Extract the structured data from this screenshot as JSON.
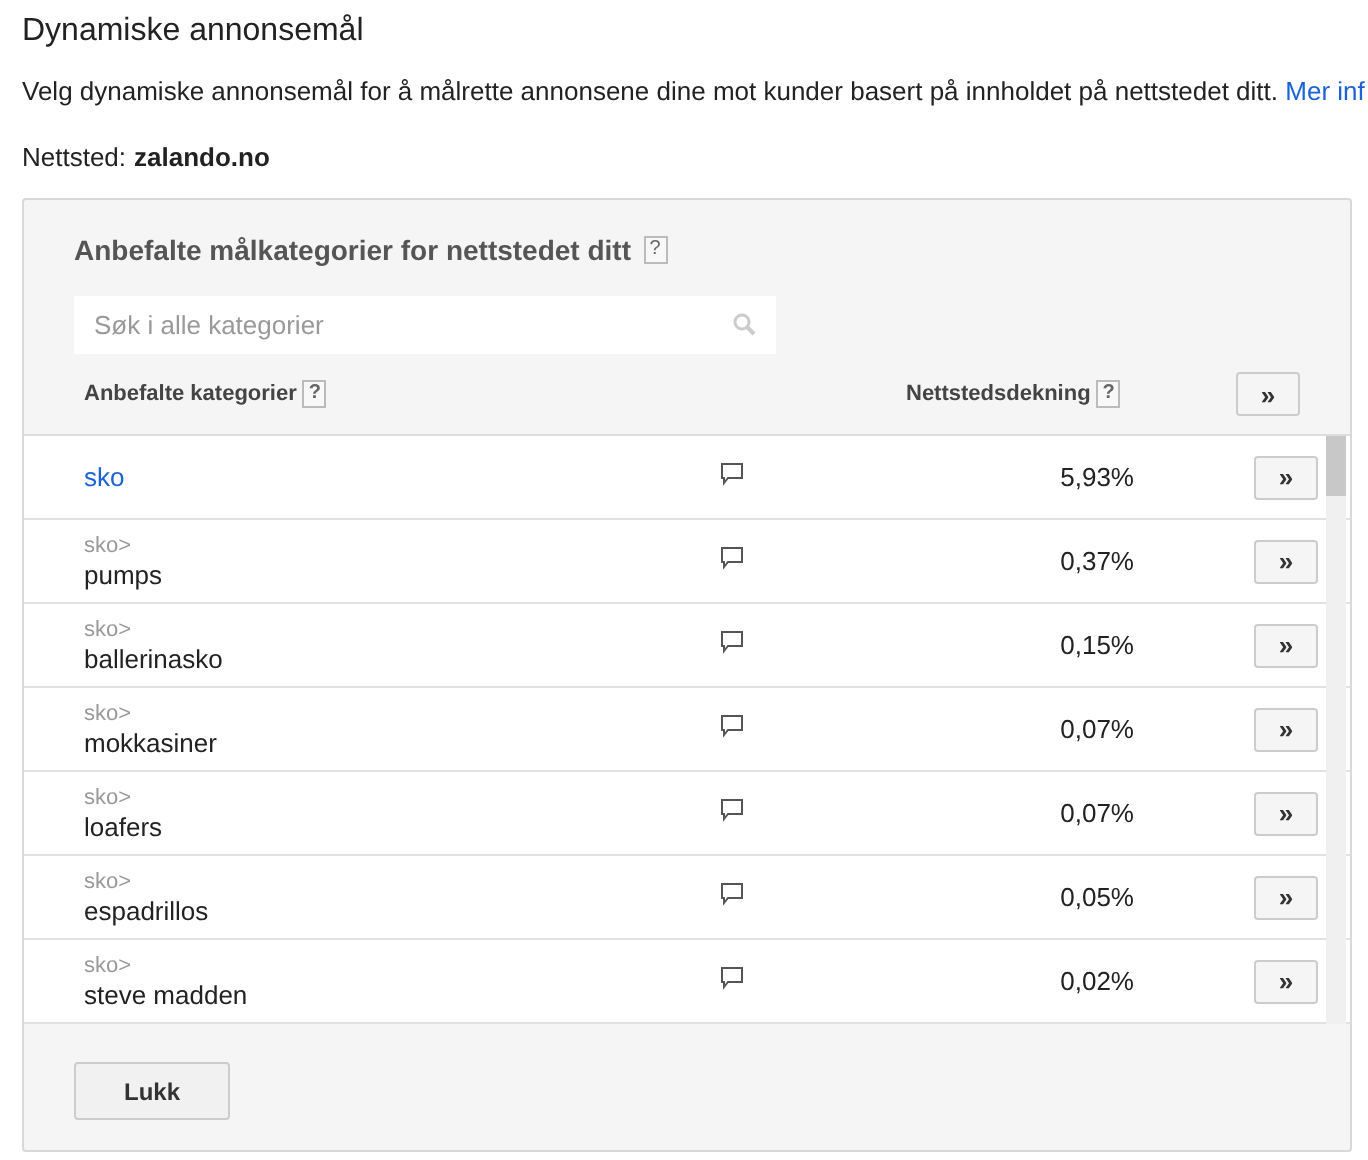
{
  "title": "Dynamiske annonsemål",
  "description": "Velg dynamiske annonsemål for å målrette annonsene dine mot kunder basert på innholdet på nettstedet ditt.",
  "more_link": "Mer inf",
  "site": {
    "label": "Nettsted:",
    "value": "zalando.no"
  },
  "panel": {
    "heading": "Anbefalte målkategorier for nettstedet ditt",
    "help": "?",
    "search": {
      "placeholder": "Søk i alle kategorier"
    },
    "columns": [
      {
        "label": "Anbefalte kategorier",
        "help": "?"
      },
      {
        "label": "Nettstedsdekning",
        "help": "?"
      }
    ],
    "add_all_button": "»",
    "rows": [
      {
        "kind": "top",
        "name": "sko",
        "coverage": "5,93%",
        "button": "»"
      },
      {
        "kind": "child",
        "parent": "sko>",
        "name": "pumps",
        "coverage": "0,37%",
        "button": "»"
      },
      {
        "kind": "child",
        "parent": "sko>",
        "name": "ballerinasko",
        "coverage": "0,15%",
        "button": "»"
      },
      {
        "kind": "child",
        "parent": "sko>",
        "name": "mokkasiner",
        "coverage": "0,07%",
        "button": "»"
      },
      {
        "kind": "child",
        "parent": "sko>",
        "name": "loafers",
        "coverage": "0,07%",
        "button": "»"
      },
      {
        "kind": "child",
        "parent": "sko>",
        "name": "espadrillos",
        "coverage": "0,05%",
        "button": "»"
      },
      {
        "kind": "child",
        "parent": "sko>",
        "name": "steve madden",
        "coverage": "0,02%",
        "button": "»"
      }
    ],
    "close_button": "Lukk"
  }
}
